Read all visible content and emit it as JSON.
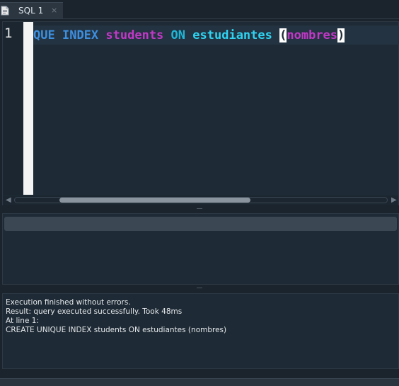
{
  "tabs": [
    {
      "label": "SQL 1",
      "close": "×",
      "icon": "document-icon"
    }
  ],
  "editor": {
    "line_number": "1",
    "tokens": {
      "kw1": "QUE",
      "sp1": " ",
      "kw2": "INDEX",
      "sp2": " ",
      "ident1": "students",
      "sp3": " ",
      "kw3": "ON",
      "sp4": " ",
      "table": "estudiantes",
      "sp5": " ",
      "paren_open": "(",
      "column": "nombres",
      "paren_close": ")"
    },
    "scroll_left_arrow": "◀",
    "scroll_right_arrow": "▶"
  },
  "messages": {
    "line1": "Execution finished without errors.",
    "line2": "Result: query executed successfully. Took 48ms",
    "line3": "At line 1:",
    "line4": "CREATE UNIQUE INDEX students ON estudiantes (nombres)"
  },
  "colors": {
    "keyword": "#3d8fe0",
    "identifier": "#c238c8",
    "table": "#2ed4f2",
    "background": "#1b232c"
  }
}
